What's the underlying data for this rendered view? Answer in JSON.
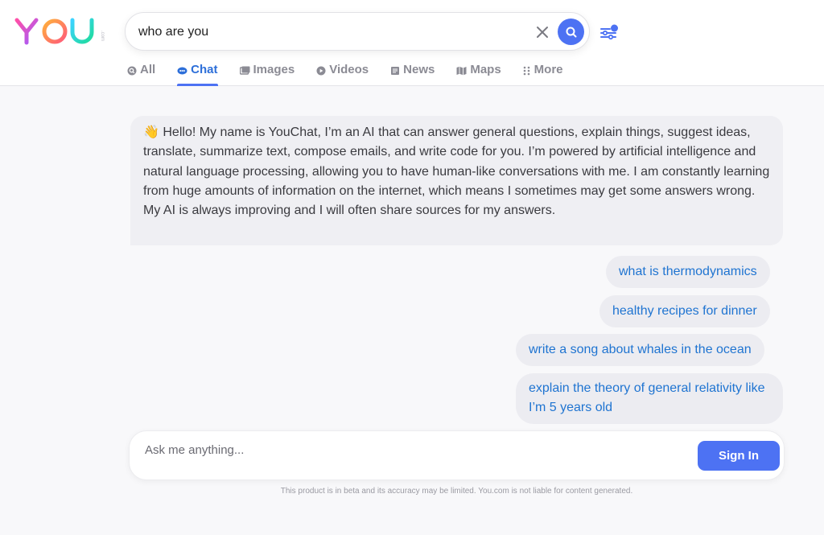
{
  "logo": {
    "text": "YOU",
    "superscript": ".com"
  },
  "search": {
    "value": "who are you"
  },
  "tabs": [
    {
      "label": "All",
      "icon": "search-circle-icon"
    },
    {
      "label": "Chat",
      "icon": "chat-bubble-icon",
      "active": true
    },
    {
      "label": "Images",
      "icon": "images-icon"
    },
    {
      "label": "Videos",
      "icon": "play-circle-icon"
    },
    {
      "label": "News",
      "icon": "newspaper-icon"
    },
    {
      "label": "Maps",
      "icon": "map-icon"
    },
    {
      "label": "More",
      "icon": "dots-grid-icon"
    }
  ],
  "chat": {
    "bot_emoji": "👋",
    "bot_message": "Hello! My name is YouChat, I’m an AI that can answer general questions, explain things, suggest ideas, translate, summarize text, compose emails, and write code for you. I’m powered by artificial intelligence and natural language processing, allowing you to have human-like conversations with me. I am constantly learning from huge amounts of information on the internet, which means I sometimes may get some answers wrong. My AI is always improving and I will often share sources for my answers.",
    "suggestions": [
      "what is thermodynamics",
      "healthy recipes for dinner",
      "write a song about whales in the ocean",
      "explain the theory of general relativity like I’m 5 years old"
    ],
    "input_placeholder": "Ask me anything...",
    "signin_label": "Sign In"
  },
  "disclaimer": "This product is in beta and its accuracy may be limited. You.com is not liable for content generated.",
  "colors": {
    "accent": "#4d72f3",
    "link": "#1f74d1",
    "bubble": "#efeff3"
  }
}
